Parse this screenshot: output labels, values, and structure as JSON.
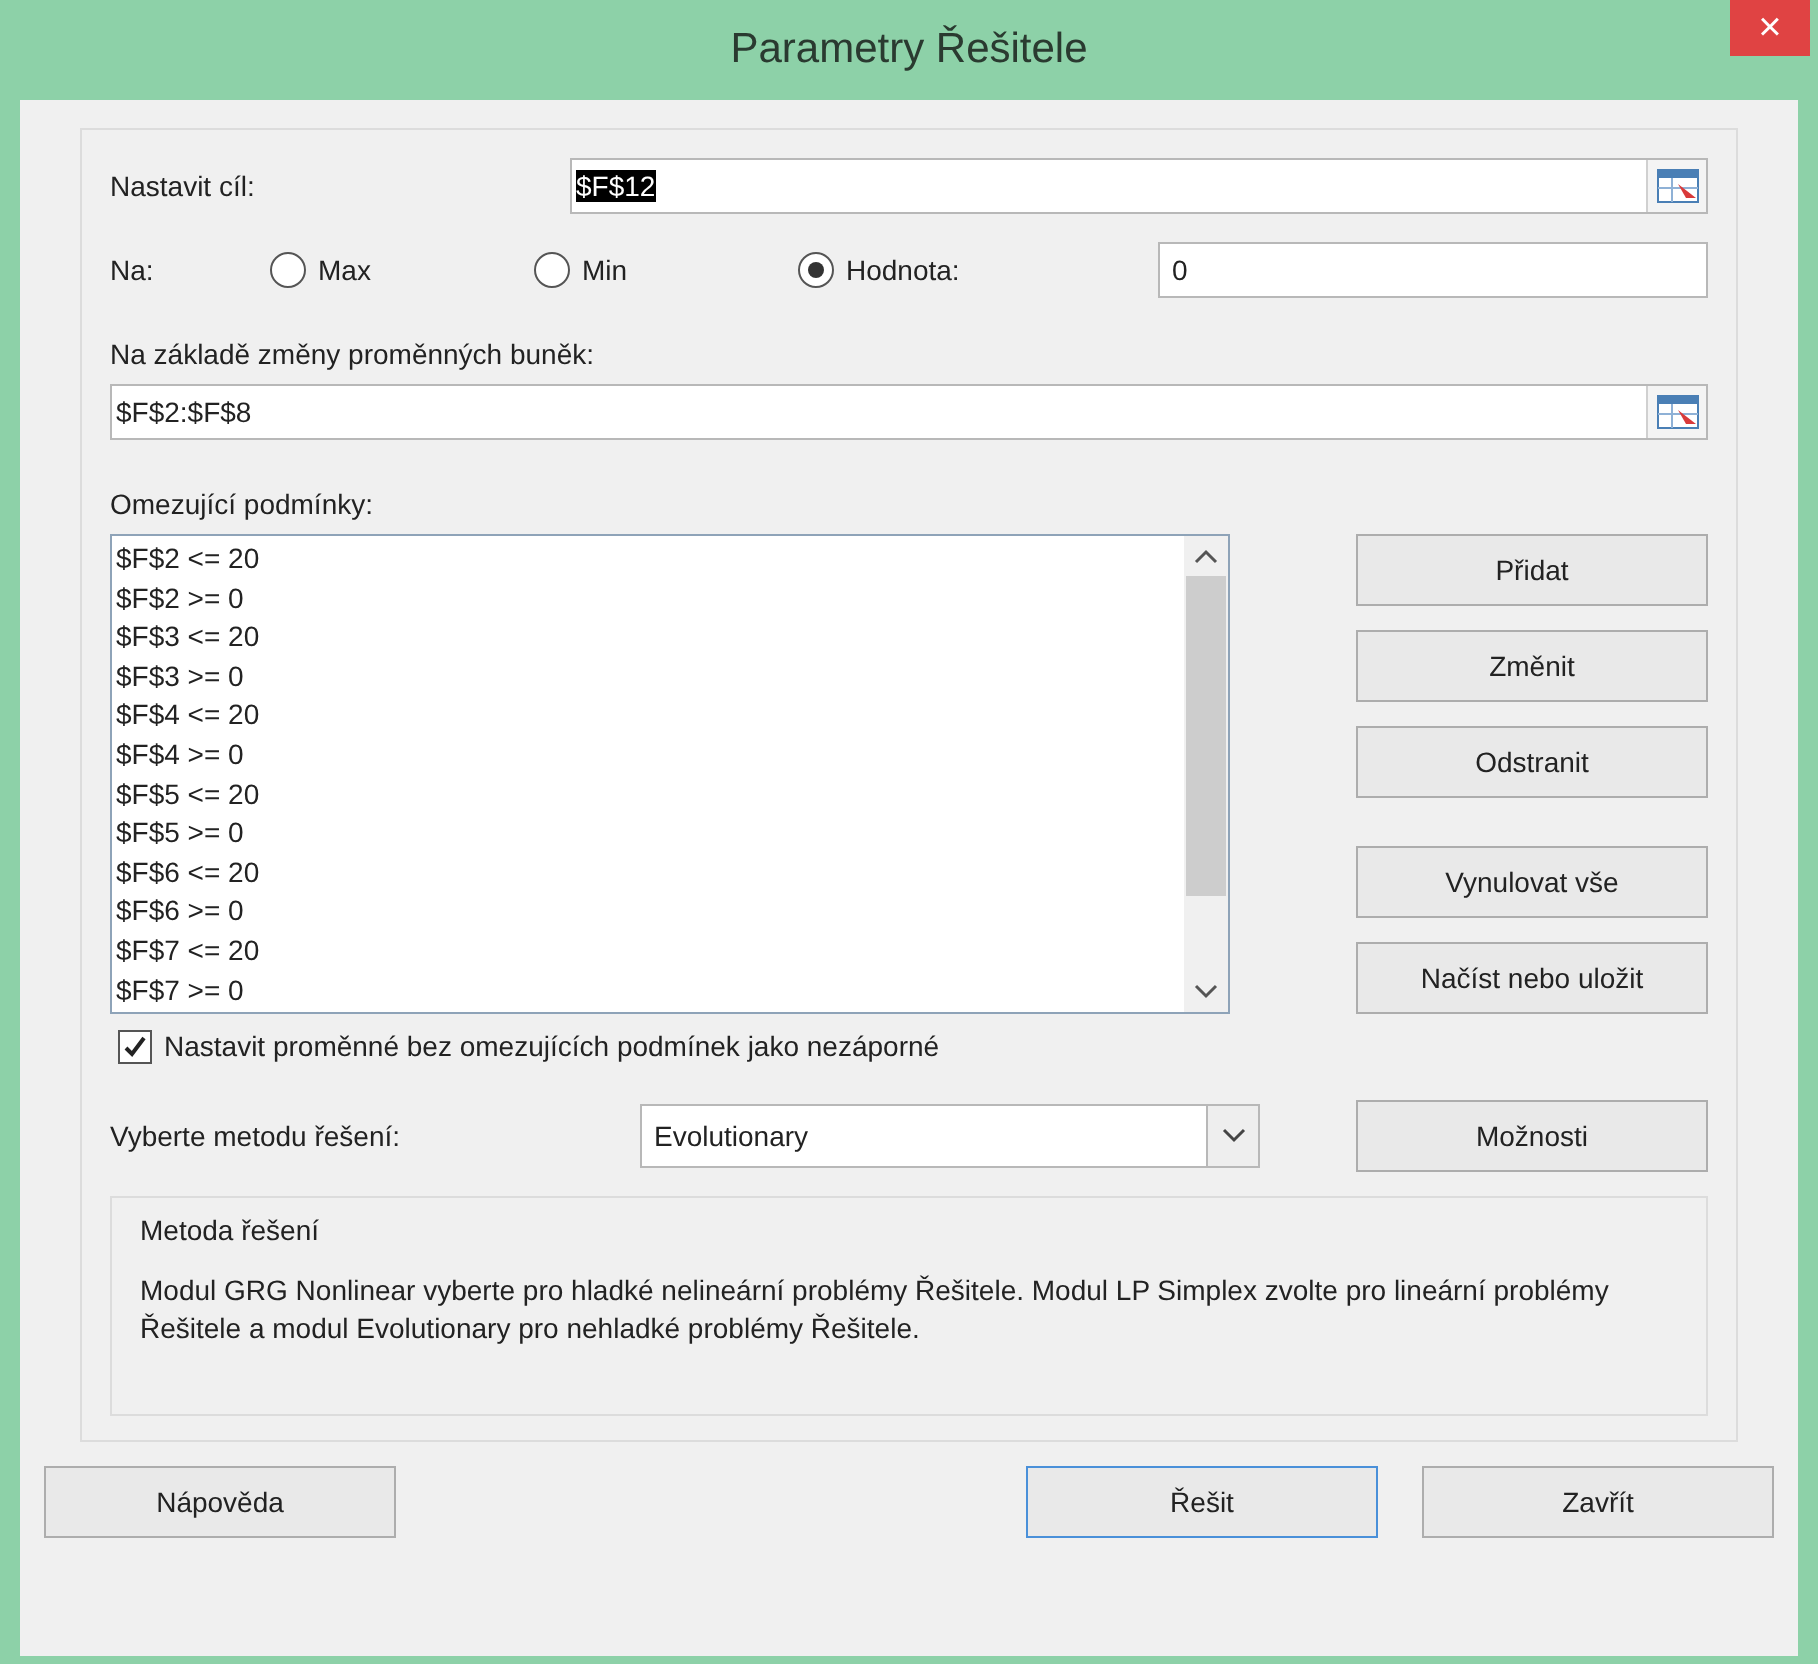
{
  "window": {
    "title": "Parametry Řešitele",
    "close": "×"
  },
  "objective": {
    "label": "Nastavit cíl:",
    "value": "$F$12",
    "selected": true
  },
  "to": {
    "label": "Na:",
    "options": [
      {
        "label": "Max",
        "selected": false
      },
      {
        "label": "Min",
        "selected": false
      },
      {
        "label": "Hodnota:",
        "selected": true
      }
    ],
    "value": "0"
  },
  "variables": {
    "label": "Na základě změny proměnných buněk:",
    "value": "$F$2:$F$8"
  },
  "constraints": {
    "label": "Omezující podmínky:",
    "items": [
      "$F$2 <= 20",
      "$F$2 >= 0",
      "$F$3 <= 20",
      "$F$3 >= 0",
      "$F$4 <= 20",
      "$F$4 >= 0",
      "$F$5 <= 20",
      "$F$5 >= 0",
      "$F$6 <= 20",
      "$F$6 >= 0",
      "$F$7 <= 20",
      "$F$7 >= 0"
    ]
  },
  "side_button_groups": [
    [
      "Přidat",
      "Změnit",
      "Odstranit"
    ],
    [
      "Vynulovat vše",
      "Načíst nebo uložit"
    ]
  ],
  "nonnegative": {
    "label": "Nastavit proměnné bez omezujících podmínek jako nezáporné",
    "checked": true
  },
  "method": {
    "label": "Vyberte metodu řešení:",
    "value": "Evolutionary",
    "button": "Možnosti"
  },
  "description": {
    "title": "Metoda řešení",
    "text": "Modul GRG Nonlinear vyberte pro hladké nelineární problémy Řešitele. Modul LP Simplex zvolte pro lineární problémy Řešitele a modul Evolutionary pro nehladké problémy Řešitele."
  },
  "footer": {
    "left": [
      {
        "label": "Nápověda",
        "default": false
      }
    ],
    "right": [
      {
        "label": "Řešit",
        "default": true
      },
      {
        "label": "Zavřít",
        "default": false
      }
    ]
  }
}
